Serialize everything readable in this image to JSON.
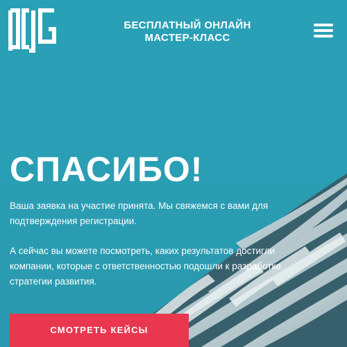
{
  "header": {
    "title_line1": "БЕСПЛАТНЫЙ ОНЛАЙН",
    "title_line2": "МАСТЕР-КЛАСС",
    "logo_icon": "dg-logo-icon",
    "menu_icon": "hamburger-menu-icon"
  },
  "main": {
    "title": "СПАСИБО!",
    "paragraph1": "Ваша заявка на участие принята. Мы свяжемся с вами для подтверждения регистрации.",
    "paragraph2": "А сейчас вы можете посмотреть, каких результатов достигли компании, которые с ответственностью подошли к разработке стратегии развития.",
    "cta_label": "СМОТРЕТЬ КЕЙСЫ"
  },
  "colors": {
    "background": "#2a9fb4",
    "cta": "#e8374f",
    "text": "#ffffff"
  }
}
